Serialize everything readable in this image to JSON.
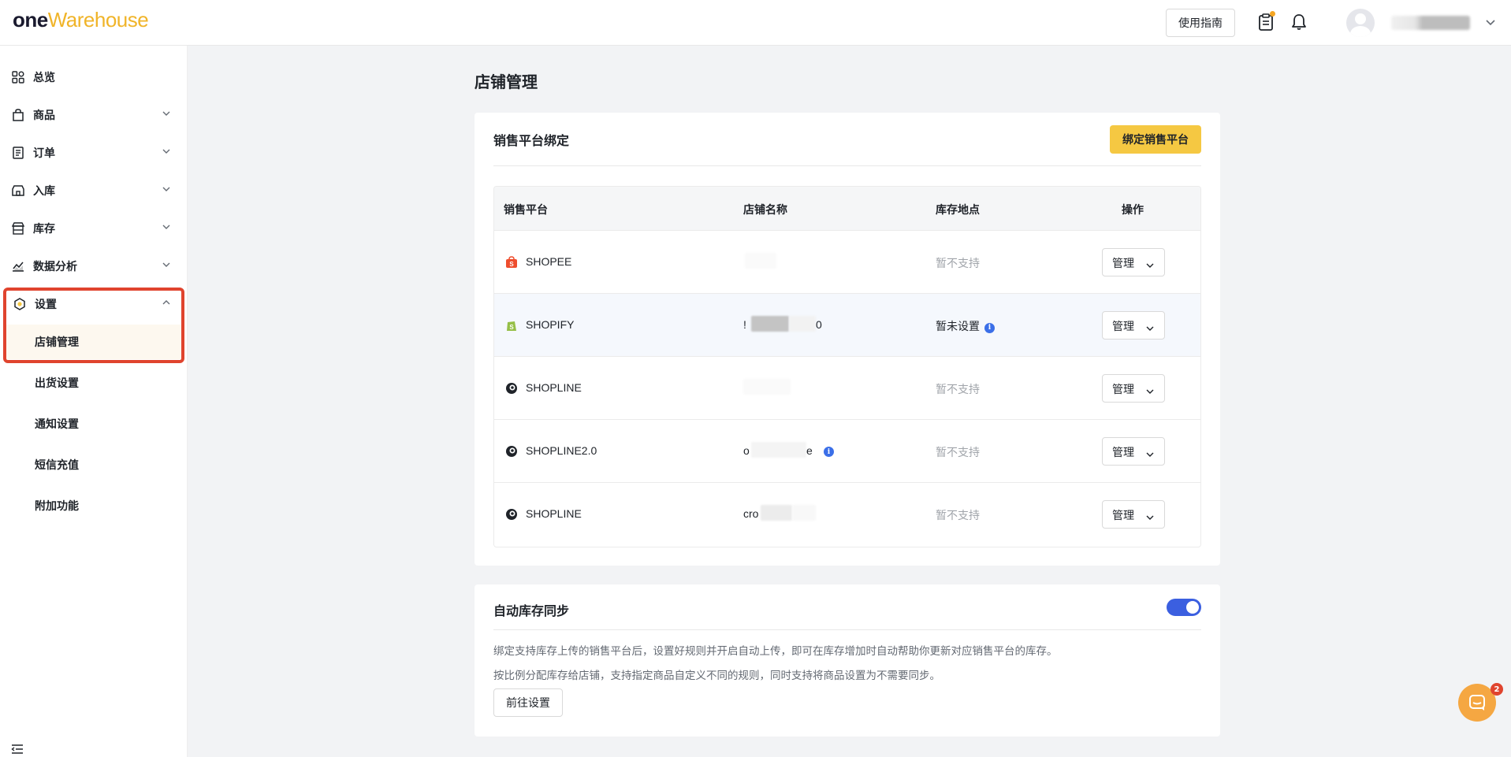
{
  "header": {
    "logo_one": "one",
    "logo_warehouse": "Warehouse",
    "guide_label": "使用指南"
  },
  "sidebar": {
    "items": [
      {
        "label": "总览"
      },
      {
        "label": "商品"
      },
      {
        "label": "订单"
      },
      {
        "label": "入库"
      },
      {
        "label": "库存"
      },
      {
        "label": "数据分析"
      },
      {
        "label": "设置"
      }
    ],
    "settings_sub": [
      {
        "label": "店铺管理"
      },
      {
        "label": "出货设置"
      },
      {
        "label": "通知设置"
      },
      {
        "label": "短信充值"
      },
      {
        "label": "附加功能"
      }
    ]
  },
  "main": {
    "page_title": "店铺管理",
    "platform_card": {
      "title": "销售平台绑定",
      "bind_button": "绑定销售平台",
      "columns": [
        "销售平台",
        "店铺名称",
        "库存地点",
        "操作"
      ],
      "rows": [
        {
          "platform": "SHOPEE",
          "store": "",
          "location": "暂不支持",
          "action": "管理"
        },
        {
          "platform": "SHOPIFY",
          "store_prefix": "!",
          "store_suffix": "0",
          "location": "暂未设置",
          "action": "管理"
        },
        {
          "platform": "SHOPLINE",
          "store": "",
          "location": "暂不支持",
          "action": "管理"
        },
        {
          "platform": "SHOPLINE2.0",
          "store_prefix": "o",
          "store_suffix": "e",
          "location": "暂不支持",
          "action": "管理"
        },
        {
          "platform": "SHOPLINE",
          "store_prefix": "cro",
          "location": "暂不支持",
          "action": "管理"
        }
      ]
    },
    "sync_card": {
      "title": "自动库存同步",
      "enabled": true,
      "desc1": "绑定支持库存上传的销售平台后，设置好规则并开启自动上传，即可在库存增加时自动帮助你更新对应销售平台的库存。",
      "desc2": "按比例分配库存给店铺，支持指定商品自定义不同的规则，同时支持将商品设置为不需要同步。",
      "goto_button": "前往设置"
    }
  },
  "chat": {
    "badge": "2"
  },
  "colors": {
    "accent": "#f5c842",
    "highlight": "#e0442e",
    "toggle": "#3b5fe0"
  }
}
